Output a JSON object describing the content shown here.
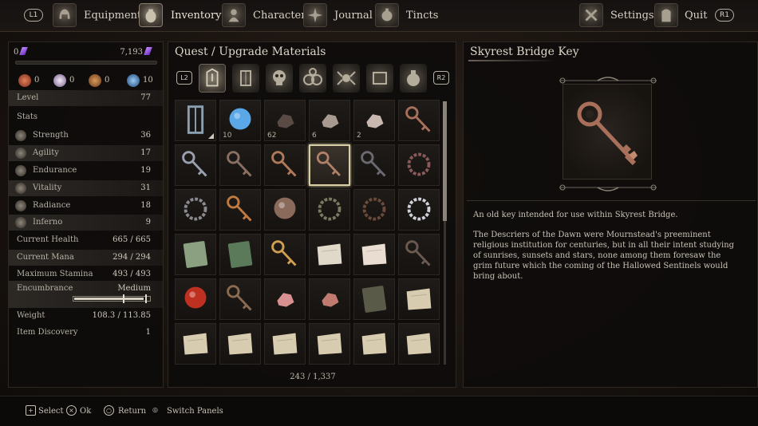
{
  "topbar": {
    "left_shoulder": "L1",
    "right_shoulder": "R1",
    "tabs": [
      {
        "label": "Equipment",
        "icon": "helmet-icon"
      },
      {
        "label": "Inventory",
        "icon": "pouch-icon"
      },
      {
        "label": "Character",
        "icon": "character-icon"
      },
      {
        "label": "Journal",
        "icon": "journal-icon"
      },
      {
        "label": "Tincts",
        "icon": "tinct-icon"
      }
    ],
    "active_tab": "Inventory",
    "settings_label": "Settings",
    "quit_label": "Quit"
  },
  "character": {
    "souls_left": "0",
    "souls_right": "7,193",
    "resources": [
      {
        "value": "0",
        "icon": "hand-icon"
      },
      {
        "value": "0",
        "icon": "orb-icon"
      },
      {
        "value": "0",
        "icon": "ore-icon"
      },
      {
        "value": "10",
        "icon": "moon-icon"
      }
    ],
    "level_label": "Level",
    "level_value": "77",
    "stats_label": "Stats",
    "stats": [
      {
        "label": "Strength",
        "value": "36"
      },
      {
        "label": "Agility",
        "value": "17"
      },
      {
        "label": "Endurance",
        "value": "19"
      },
      {
        "label": "Vitality",
        "value": "31"
      },
      {
        "label": "Radiance",
        "value": "18"
      },
      {
        "label": "Inferno",
        "value": "9"
      }
    ],
    "current_health_label": "Current Health",
    "current_health_value": "665 / 665",
    "current_mana_label": "Current Mana",
    "current_mana_value": "294 / 294",
    "max_stamina_label": "Maximum Stamina",
    "max_stamina_value": "493 / 493",
    "encumbrance_label": "Encumbrance",
    "encumbrance_value": "Medium",
    "encumbrance_fill": 0.93,
    "weight_label": "Weight",
    "weight_value": "108.3 / 113.85",
    "item_discovery_label": "Item Discovery",
    "item_discovery_value": "1"
  },
  "inventory": {
    "section_title": "Quest / Upgrade Materials",
    "left_shoulder": "L2",
    "right_shoulder": "R2",
    "categories": [
      "quest-icon",
      "lantern-icon",
      "skull-icon",
      "ring-icon",
      "spider-icon",
      "tome-icon",
      "pouch-icon"
    ],
    "page_count": "243 / 1,337",
    "items": [
      {
        "icon": "lantern-relic-icon",
        "count": "",
        "marker": true
      },
      {
        "icon": "blue-creature-icon",
        "count": "10"
      },
      {
        "icon": "dark-ore-icon",
        "count": "62"
      },
      {
        "icon": "stone-chunk-icon",
        "count": "6"
      },
      {
        "icon": "crystal-chunk-icon",
        "count": "2"
      },
      {
        "icon": "rusted-key-icon",
        "count": ""
      },
      {
        "icon": "ornate-key-icon",
        "count": ""
      },
      {
        "icon": "iron-key-icon",
        "count": ""
      },
      {
        "icon": "bronze-key-icon",
        "count": ""
      },
      {
        "icon": "skyrest-bridge-key-icon",
        "count": "",
        "selected": true
      },
      {
        "icon": "dark-key-icon",
        "count": ""
      },
      {
        "icon": "beaded-amulet-icon",
        "count": ""
      },
      {
        "icon": "chain-amulet-icon",
        "count": ""
      },
      {
        "icon": "scissors-icon",
        "count": ""
      },
      {
        "icon": "severed-head-icon",
        "count": ""
      },
      {
        "icon": "horseshoe-icon",
        "count": ""
      },
      {
        "icon": "leather-strap-icon",
        "count": ""
      },
      {
        "icon": "pearl-bracelet-icon",
        "count": ""
      },
      {
        "icon": "green-tablet-icon",
        "count": ""
      },
      {
        "icon": "moss-tablet-icon",
        "count": ""
      },
      {
        "icon": "golden-sword-icon",
        "count": ""
      },
      {
        "icon": "sealed-letter-icon",
        "count": ""
      },
      {
        "icon": "open-letter-icon",
        "count": ""
      },
      {
        "icon": "banner-staff-icon",
        "count": ""
      },
      {
        "icon": "red-eye-orb-icon",
        "count": ""
      },
      {
        "icon": "crossbow-icon",
        "count": ""
      },
      {
        "icon": "meat-icon",
        "count": ""
      },
      {
        "icon": "ribs-icon",
        "count": ""
      },
      {
        "icon": "journal-book-icon",
        "count": ""
      },
      {
        "icon": "parchment-icon",
        "count": ""
      },
      {
        "icon": "parchment-icon",
        "count": ""
      },
      {
        "icon": "parchment-icon",
        "count": ""
      },
      {
        "icon": "parchment-icon",
        "count": ""
      },
      {
        "icon": "parchment-icon",
        "count": ""
      },
      {
        "icon": "parchment-icon",
        "count": ""
      },
      {
        "icon": "parchment-icon",
        "count": ""
      }
    ]
  },
  "details": {
    "title": "Skyrest Bridge Key",
    "short_description": "An old key intended for use within Skyrest Bridge.",
    "lore": "The Descriers of the Dawn were Mournstead's preeminent religious institution for centuries, but in all their intent studying of sunrises, sunsets and stars, none among them foresaw the grim future which the coming of the Hallowed Sentinels would bring about."
  },
  "bottombar": {
    "hints": [
      {
        "icon": "dpad-icon",
        "label": "Select"
      },
      {
        "icon": "cross-button-icon",
        "label": "Ok"
      },
      {
        "icon": "circle-button-icon",
        "label": "Return"
      },
      {
        "icon": "touchpad-icon",
        "label": "Switch Panels"
      }
    ]
  }
}
